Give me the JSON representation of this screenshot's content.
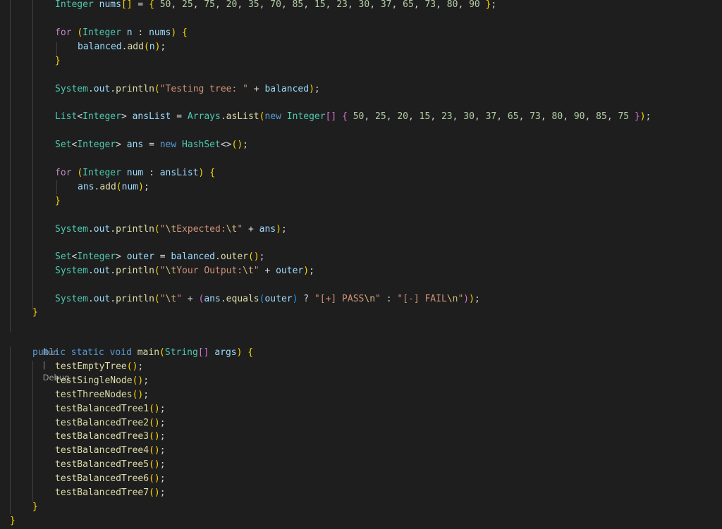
{
  "editor": {
    "lines": [
      {
        "id": "nums-decl",
        "text": "Integer nums[] = { 50, 25, 75, 20, 35, 70, 85, 15, 23, 30, 37, 65, 73, 80, 90 };"
      },
      {
        "id": "for-nums",
        "text": "for (Integer n : nums) {"
      },
      {
        "id": "balanced-add",
        "text": "balanced.add(n);"
      },
      {
        "id": "close-for-nums",
        "text": "}"
      },
      {
        "id": "print-testing",
        "text": "System.out.println(\"Testing tree: \" + balanced);"
      },
      {
        "id": "anslist-decl",
        "text": "List<Integer> ansList = Arrays.asList(new Integer[] { 50, 25, 20, 15, 23, 30, 37, 65, 73, 80, 90, 85, 75 });"
      },
      {
        "id": "ans-decl",
        "text": "Set<Integer> ans = new HashSet<>();"
      },
      {
        "id": "for-anslist",
        "text": "for (Integer num : ansList) {"
      },
      {
        "id": "ans-add",
        "text": "ans.add(num);"
      },
      {
        "id": "close-for-anslist",
        "text": "}"
      },
      {
        "id": "print-expected",
        "text": "System.out.println(\"\\tExpected:\\t\" + ans);"
      },
      {
        "id": "outer-decl",
        "text": "Set<Integer> outer = balanced.outer();"
      },
      {
        "id": "print-output",
        "text": "System.out.println(\"\\tYour Output:\\t\" + outer);"
      },
      {
        "id": "print-result",
        "text": "System.out.println(\"\\t\" + (ans.equals(outer) ? \"[+] PASS\\n\" : \"[-] FAIL\\n\"));"
      },
      {
        "id": "close-method",
        "text": "}"
      },
      {
        "id": "main-decl",
        "text": "public static void main(String[] args) {"
      },
      {
        "id": "call-1",
        "text": "testEmptyTree();"
      },
      {
        "id": "call-2",
        "text": "testSingleNode();"
      },
      {
        "id": "call-3",
        "text": "testThreeNodes();"
      },
      {
        "id": "call-4",
        "text": "testBalancedTree1();"
      },
      {
        "id": "call-5",
        "text": "testBalancedTree2();"
      },
      {
        "id": "call-6",
        "text": "testBalancedTree3();"
      },
      {
        "id": "call-7",
        "text": "testBalancedTree4();"
      },
      {
        "id": "call-8",
        "text": "testBalancedTree5();"
      },
      {
        "id": "call-9",
        "text": "testBalancedTree6();"
      },
      {
        "id": "call-10",
        "text": "testBalancedTree7();"
      },
      {
        "id": "close-main",
        "text": "}"
      },
      {
        "id": "close-class",
        "text": "}"
      }
    ],
    "codelens": {
      "run": "Run",
      "separator": "|",
      "debug": "Debug"
    }
  },
  "colors": {
    "background": "#1e1e1e",
    "keyword": "#569cd6",
    "control": "#c586c0",
    "type": "#4ec9b0",
    "variable": "#9cdcfe",
    "function": "#dcdcaa",
    "string": "#ce9178",
    "number": "#b5cea8"
  }
}
